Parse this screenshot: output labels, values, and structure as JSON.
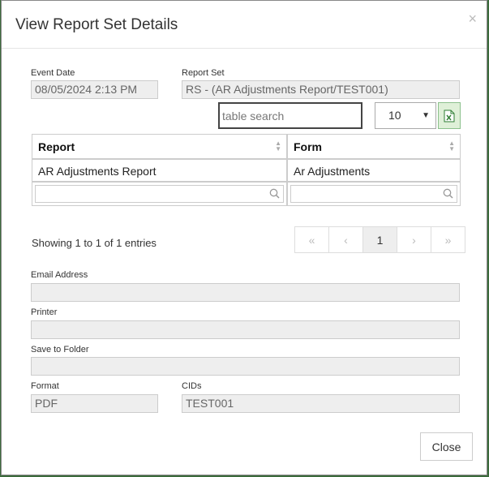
{
  "modal": {
    "title": "View Report Set Details",
    "close_icon": "×"
  },
  "event_date": {
    "label": "Event Date",
    "value": "08/05/2024 2:13 PM"
  },
  "report_set": {
    "label": "Report Set",
    "value": "RS - (AR Adjustments Report/TEST001)"
  },
  "table_search": {
    "placeholder": "table search"
  },
  "page_size": {
    "value": "10"
  },
  "table": {
    "columns": [
      "Report",
      "Form"
    ],
    "rows": [
      [
        "AR Adjustments Report",
        "Ar Adjustments"
      ]
    ]
  },
  "info": "Showing 1 to 1 of 1 entries",
  "pagination": {
    "first": "«",
    "prev": "‹",
    "current": "1",
    "next": "›",
    "last": "»"
  },
  "email": {
    "label": "Email Address",
    "value": ""
  },
  "printer": {
    "label": "Printer",
    "value": ""
  },
  "save_folder": {
    "label": "Save to Folder",
    "value": ""
  },
  "format": {
    "label": "Format",
    "value": "PDF"
  },
  "cids": {
    "label": "CIDs",
    "value": "TEST001"
  },
  "footer": {
    "close_label": "Close"
  }
}
